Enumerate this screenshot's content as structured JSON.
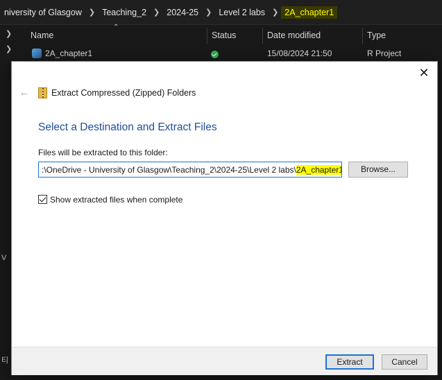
{
  "breadcrumb": {
    "items": [
      "niversity of Glasgow",
      "Teaching_2",
      "2024-25",
      "Level 2 labs",
      "2A_chapter1"
    ]
  },
  "explorer": {
    "columns": [
      "Name",
      "Status",
      "Date modified",
      "Type"
    ],
    "rows": [
      {
        "name": "2A_chapter1",
        "status_icon": "sync-ok-icon",
        "date_modified": "15/08/2024 21:50",
        "type": "R Project"
      }
    ],
    "edge_glyphs": [
      "V",
      "티"
    ]
  },
  "dialog": {
    "caption": "Extract Compressed (Zipped) Folders",
    "heading": "Select a Destination and Extract Files",
    "path_label": "Files will be extracted to this folder:",
    "path_prefix": ":\\OneDrive - University of Glasgow\\Teaching_2\\2024-25\\Level 2 labs\\",
    "path_highlight": "2A_chapter1",
    "browse_label": "Browse...",
    "show_files_label": "Show extracted files when complete",
    "show_files_checked": true,
    "extract_label": "Extract",
    "cancel_label": "Cancel"
  },
  "colors": {
    "heading": "#1f4e99",
    "highlight": "#ffff00",
    "focus_border": "#1a73d9"
  }
}
